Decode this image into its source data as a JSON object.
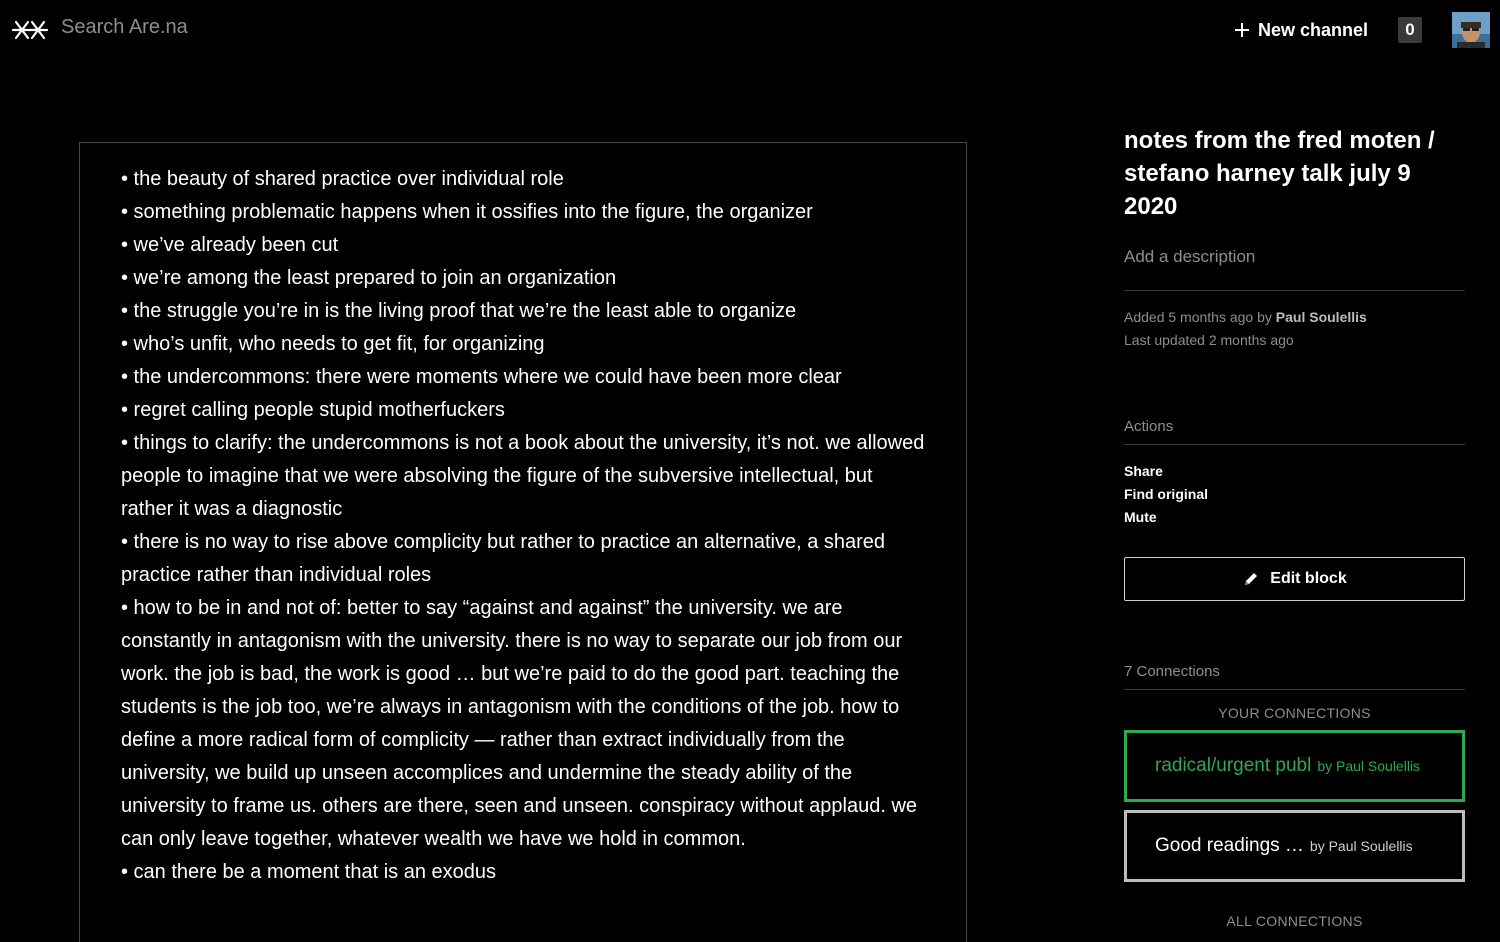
{
  "header": {
    "search_placeholder": "Search Are.na",
    "new_channel_label": "New channel",
    "notification_count": "0"
  },
  "block": {
    "paragraphs": [
      "• the beauty of shared practice over individual role",
      "• something problematic happens when it ossifies into the figure, the organizer",
      "• we’ve already been cut",
      "• we’re among the least prepared to join an organization",
      "• the struggle you’re in is the living proof that we’re the least able to organize",
      "• who’s unfit, who needs to get fit, for organizing",
      "• the undercommons: there were moments where we could have been more clear",
      "• regret calling people stupid motherfuckers",
      "• things to clarify: the undercommons is not a book about the university, it’s not. we allowed people to imagine that we were absolving the figure of the subversive intellectual, but rather it was a diagnostic",
      "• there is no way to rise above complicity but rather to practice an alternative, a shared practice rather than individual roles",
      "• how to be in and not of: better to say “against and against” the university. we are constantly in antagonism with the university. there is no way to separate our job from our work. the job is bad, the work is good … but we’re paid to do the good part. teaching the students is the job too, we’re always in antagonism with the conditions of the job. how to define a more radical form of complicity — rather than extract individually from the university, we build up unseen accomplices and undermine the steady ability of the university to frame us. others are there, seen and unseen. conspiracy without applaud. we can only leave together, whatever wealth we have we hold in common.",
      "• can there be a moment that is an exodus"
    ]
  },
  "sidebar": {
    "title": "notes from the fred moten / stefano harney talk july 9 2020",
    "description_placeholder": "Add a description",
    "added_prefix": "Added 5 months ago by",
    "added_by": "Paul Soulellis",
    "last_updated": "Last updated 2 months ago",
    "actions_label": "Actions",
    "actions": [
      "Share",
      "Find original",
      "Mute"
    ],
    "edit_label": "Edit block",
    "connections_label": "7 Connections",
    "your_connections_label": "YOUR CONNECTIONS",
    "connections": [
      {
        "title": "radical/urgent publ",
        "by": "by Paul Soulellis"
      },
      {
        "title": "Good readings  …",
        "by": "by Paul Soulellis"
      }
    ],
    "all_connections_label": "ALL CONNECTIONS"
  },
  "colors": {
    "background": "#000000",
    "accent_green": "#2fa84f",
    "muted_text": "#8e8e8e"
  }
}
